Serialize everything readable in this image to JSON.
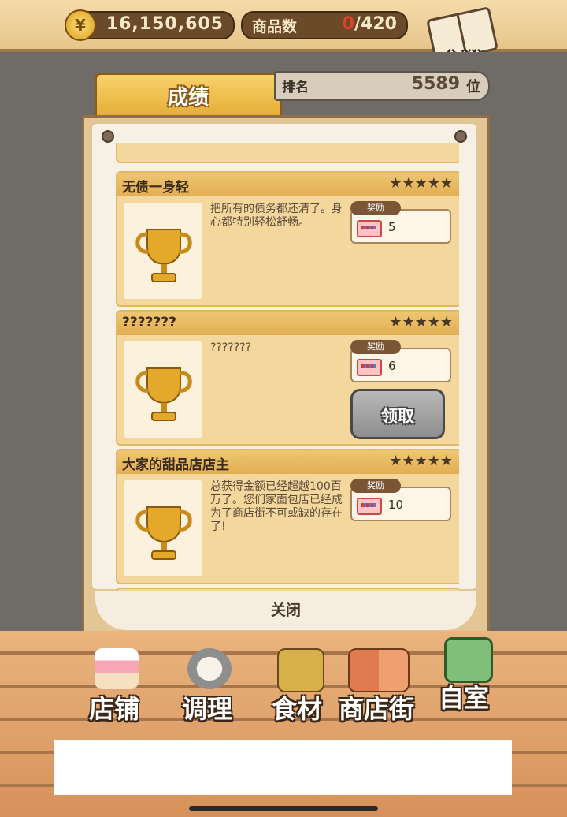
{
  "header": {
    "money": "16,150,605",
    "goods_label": "商品数",
    "goods_count": "0",
    "goods_max": "/420",
    "currency_symbol": "¥",
    "recipe_label": "食谱"
  },
  "tabs": {
    "results_label": "成绩",
    "rank_label": "排名",
    "rank_value": "5589",
    "rank_unit": "位"
  },
  "achievements": [
    {
      "title": "无债一身轻",
      "stars": "★★★★★",
      "desc": "把所有的债务都还清了。身心都特别轻松舒畅。",
      "reward_tag": "奖励",
      "reward_count": "5",
      "claim_label": ""
    },
    {
      "title": "???????",
      "stars": "★★★★★",
      "desc": "???????",
      "reward_tag": "奖励",
      "reward_count": "6",
      "claim_label": "领取"
    },
    {
      "title": "大家的甜品店店主",
      "stars": "★★★★★",
      "desc": "总获得金额已经超越100百万了。您们家面包店已经成为了商店街不可或缺的存在了!",
      "reward_tag": "奖励",
      "reward_count": "10",
      "claim_label": ""
    }
  ],
  "close_label": "关闭",
  "nav": [
    {
      "label": "店铺",
      "icon": "cake-icon"
    },
    {
      "label": "调理",
      "icon": "mixing-bowl-icon"
    },
    {
      "label": "食材",
      "icon": "flour-sack-icon"
    },
    {
      "label": "商店街",
      "icon": "shop-street-icon"
    },
    {
      "label": "自室",
      "icon": "staff-only-door-icon"
    }
  ],
  "colors": {
    "accent": "#e3a830",
    "money_zero": "#e0402a",
    "claim_button": "#9e9e9e"
  }
}
